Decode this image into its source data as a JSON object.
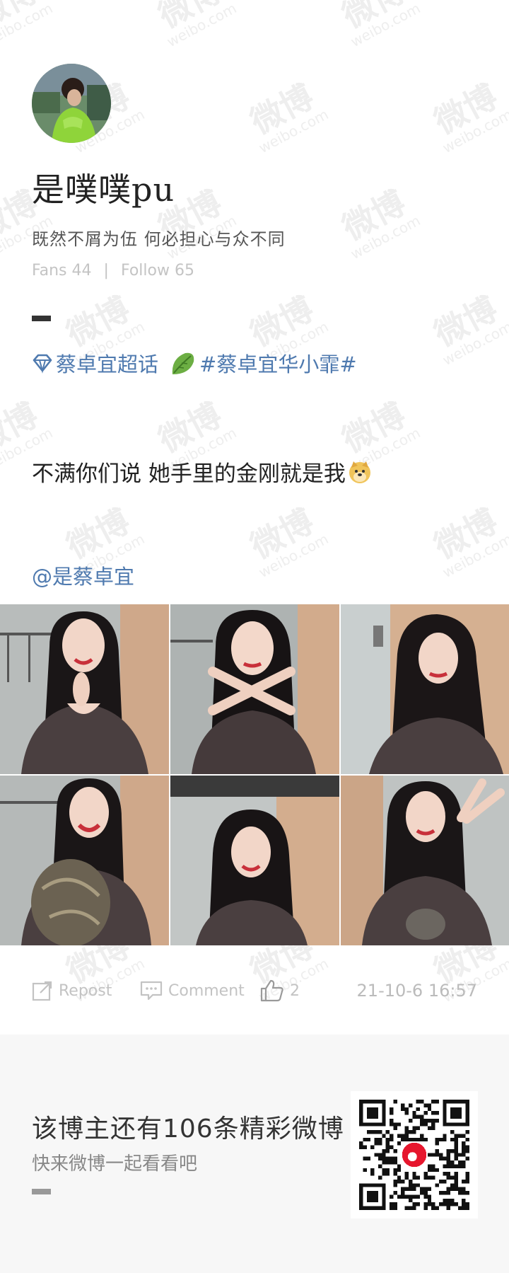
{
  "watermark": {
    "cn": "微博",
    "en": "weibo.com"
  },
  "profile": {
    "username": "是噗噗pu",
    "bio": "既然不屑为伍 何必担心与众不同",
    "fans_label": "Fans",
    "fans_count": "44",
    "follow_label": "Follow",
    "follow_count": "65",
    "separator": "|"
  },
  "post": {
    "super_topic": "蔡卓宜超话",
    "hashtag": "#蔡卓宜华小霏#",
    "text": "不满你们说 她手里的金刚就是我",
    "mention": "@是蔡卓宜",
    "photo_count": 6
  },
  "actions": {
    "repost_label": "Repost",
    "comment_label": "Comment",
    "like_count": "2",
    "timestamp": "21-10-6 16:57"
  },
  "footer": {
    "title": "该博主还有106条精彩微博",
    "subtitle": "快来微博一起看看吧"
  },
  "icons": {
    "topic": "diamond-icon",
    "leaf": "leaf-icon",
    "emoji": "doge-emoji-icon",
    "repost": "repost-icon",
    "comment": "comment-icon",
    "like": "thumbs-up-icon",
    "qr": "qr-code"
  },
  "colors": {
    "link": "#4f7aaf",
    "muted": "#c3c3c3",
    "footer_bg": "#f7f7f7"
  }
}
